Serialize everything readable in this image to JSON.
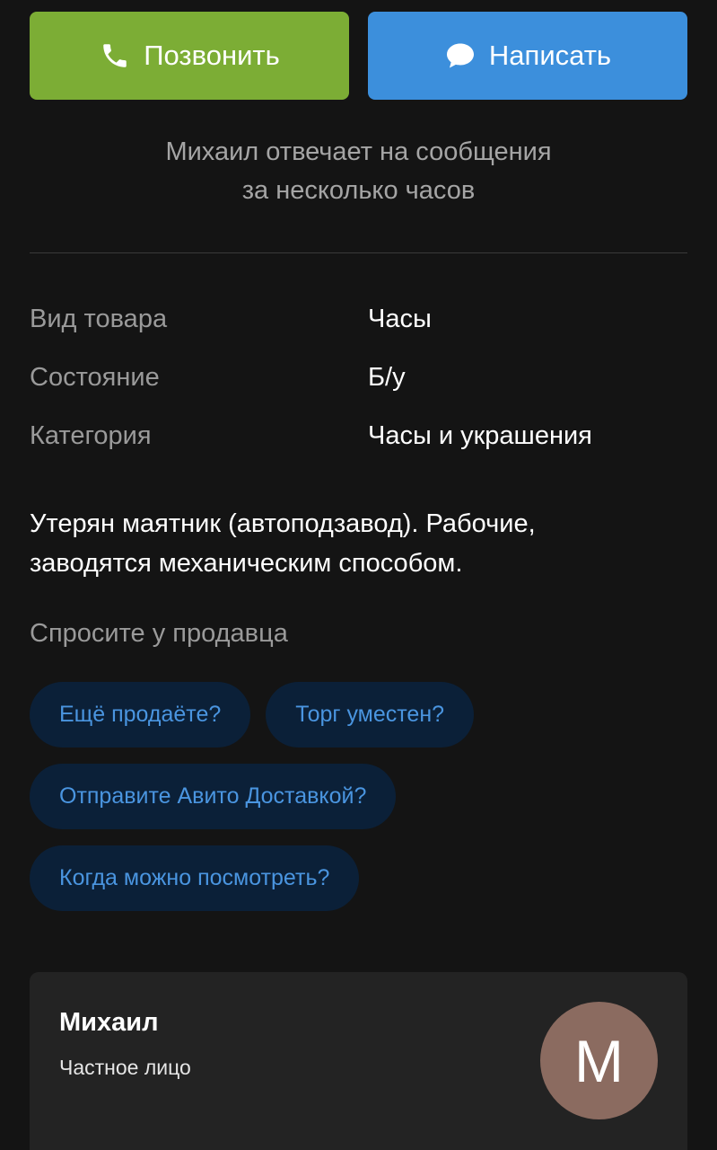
{
  "actions": {
    "call_label": "Позвонить",
    "write_label": "Написать",
    "call_icon": "phone-icon",
    "write_icon": "chat-bubble-icon"
  },
  "reply_note": {
    "line1": "Михаил отвечает на сообщения",
    "line2": "за несколько часов"
  },
  "params": [
    {
      "key": "Вид товара",
      "value": "Часы"
    },
    {
      "key": "Состояние",
      "value": "Б/у"
    },
    {
      "key": "Категория",
      "value": "Часы и украшения"
    }
  ],
  "description": {
    "line1": "Утерян маятник (автоподзавод). Рабочие,",
    "line2": "заводятся механическим способом."
  },
  "ask": {
    "title": "Спросите у продавца",
    "chips": [
      "Ещё продаёте?",
      "Торг уместен?",
      "Отправите Авито Доставкой?",
      "Когда можно посмотреть?"
    ]
  },
  "seller": {
    "name": "Михаил",
    "type": "Частное лицо",
    "avatar_letter": "М"
  },
  "colors": {
    "background": "#141414",
    "call_button": "#7cad35",
    "write_button": "#3c8fdc",
    "chip_bg": "#0b2038",
    "chip_text": "#4a95e0",
    "avatar_bg": "#8b6b60"
  }
}
